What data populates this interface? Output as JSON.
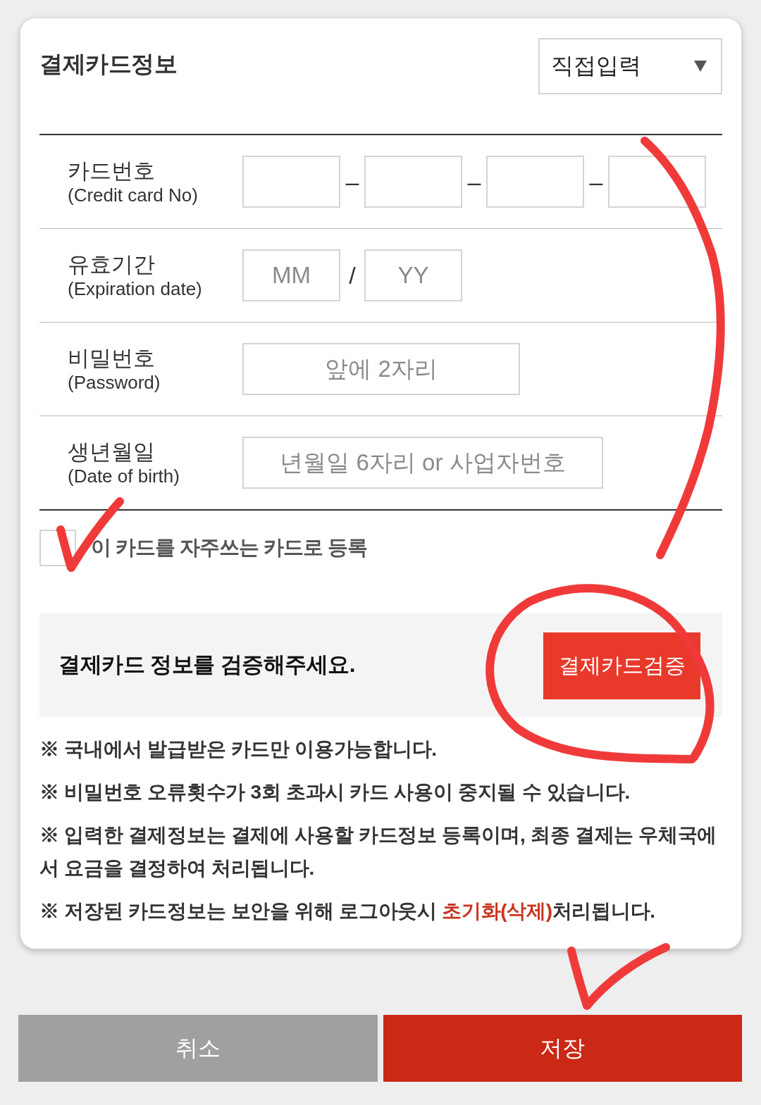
{
  "card_info": {
    "title": "결제카드정보",
    "input_method": {
      "value": "직접입력"
    }
  },
  "fields": [
    {
      "label": "카드번호",
      "sublabel": "(Credit card No)",
      "separator": "–",
      "inputs": [
        {
          "kind": "short"
        },
        {
          "kind": "short"
        },
        {
          "kind": "short"
        },
        {
          "kind": "short"
        }
      ]
    },
    {
      "label": "유효기간",
      "sublabel": "(Expiration date)",
      "separator": "/",
      "inputs": [
        {
          "kind": "short",
          "placeholder": "MM"
        },
        {
          "kind": "short",
          "placeholder": "YY"
        }
      ]
    },
    {
      "label": "비밀번호",
      "sublabel": "(Password)",
      "inputs": [
        {
          "kind": "medium",
          "placeholder": "앞에 2자리"
        }
      ]
    },
    {
      "label": "생년월일",
      "sublabel": "(Date of birth)",
      "inputs": [
        {
          "kind": "wide",
          "placeholder": "년월일 6자리 or 사업자번호"
        }
      ]
    }
  ],
  "favorite": {
    "label": "이 카드를 자주쓰는 카드로 등록",
    "checked": false
  },
  "verify": {
    "message": "결제카드 정보를 검증해주세요.",
    "button": "결제카드검증"
  },
  "notes": [
    {
      "parts": [
        {
          "text": "※ 국내에서 발급받은 카드만 이용가능합니다.",
          "highlight": false
        }
      ]
    },
    {
      "parts": [
        {
          "text": "※ 비밀번호 오류횟수가 3회 초과시 카드 사용이 중지될 수 있습니다.",
          "highlight": false
        }
      ]
    },
    {
      "parts": [
        {
          "text": "※ 입력한 결제정보는 결제에 사용할 카드정보 등록이며, 최종 결제는 우체국에서 요금을 결정하여 처리됩니다.",
          "highlight": false
        }
      ]
    },
    {
      "parts": [
        {
          "text": "※ 저장된 카드정보는 보안을 위해 로그아웃시 ",
          "highlight": false
        },
        {
          "text": "초기화(삭제)",
          "highlight": true
        },
        {
          "text": "처리됩니다.",
          "highlight": false
        }
      ]
    }
  ],
  "actions": [
    {
      "kind": "cancel",
      "label": "취소"
    },
    {
      "kind": "save",
      "label": "저장"
    }
  ]
}
